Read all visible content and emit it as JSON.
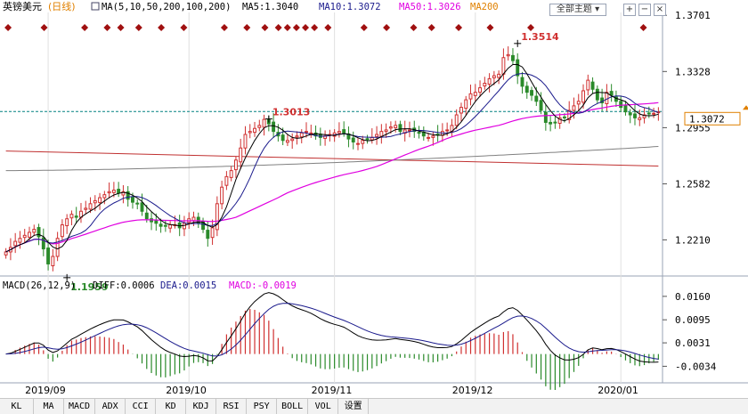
{
  "header": {
    "title": "英镑美元",
    "period": "(日线)",
    "ma_params": "MA(5,10,50,200,100,200)",
    "ma5": "MA5:1.3040",
    "ma10": "MA10:1.3072",
    "ma50": "MA50:1.3026",
    "ma200": "MA200",
    "dropdown_label": "全部主题",
    "buttons": [
      "+",
      "−",
      "×"
    ]
  },
  "macd_header": {
    "params": "MACD(26,12,9)",
    "diff": "DIFF:0.0006",
    "dea": "DEA:0.0015",
    "macd": "MACD:-0.0019"
  },
  "toolbar": [
    "KL",
    "MA",
    "MACD",
    "ADX",
    "CCI",
    "KD",
    "KDJ",
    "RSI",
    "PSY",
    "BOLL",
    "VOL",
    "设置"
  ],
  "chart_data": {
    "type": "candlestick",
    "price_axis_ticks": [
      "1.3701",
      "1.3328",
      "1.2955",
      "1.2582",
      "1.2210"
    ],
    "price_ylim": [
      1.197,
      1.372
    ],
    "current_price_label": "1.3072",
    "current_price": 1.3062,
    "annotations": [
      {
        "label": "1.3514",
        "value": 1.3514,
        "kind": "high"
      },
      {
        "label": "1.3013",
        "value": 1.3013,
        "kind": "swing-high"
      },
      {
        "label": "1.1959",
        "value": 1.1959,
        "kind": "low"
      }
    ],
    "x_date_labels": [
      {
        "label": "2019/09",
        "index": 9
      },
      {
        "label": "2019/10",
        "index": 39
      },
      {
        "label": "2019/11",
        "index": 70
      },
      {
        "label": "2019/12",
        "index": 100
      },
      {
        "label": "2020/01",
        "index": 131
      }
    ],
    "closes": [
      1.213,
      1.216,
      1.22,
      1.222,
      1.224,
      1.226,
      1.228,
      1.223,
      1.215,
      1.205,
      1.21,
      1.222,
      1.231,
      1.235,
      1.238,
      1.236,
      1.24,
      1.242,
      1.245,
      1.247,
      1.249,
      1.251,
      1.253,
      1.254,
      1.252,
      1.253,
      1.248,
      1.246,
      1.245,
      1.24,
      1.235,
      1.233,
      1.232,
      1.23,
      1.23,
      1.231,
      1.231,
      1.229,
      1.232,
      1.235,
      1.236,
      1.232,
      1.228,
      1.222,
      1.229,
      1.245,
      1.256,
      1.263,
      1.267,
      1.274,
      1.282,
      1.291,
      1.293,
      1.295,
      1.297,
      1.301,
      1.298,
      1.293,
      1.29,
      1.287,
      1.287,
      1.288,
      1.29,
      1.292,
      1.293,
      1.292,
      1.29,
      1.289,
      1.29,
      1.291,
      1.292,
      1.293,
      1.292,
      1.288,
      1.286,
      1.285,
      1.287,
      1.288,
      1.289,
      1.291,
      1.293,
      1.294,
      1.296,
      1.297,
      1.293,
      1.294,
      1.294,
      1.293,
      1.292,
      1.29,
      1.289,
      1.29,
      1.291,
      1.293,
      1.294,
      1.297,
      1.304,
      1.309,
      1.314,
      1.318,
      1.319,
      1.322,
      1.325,
      1.328,
      1.33,
      1.331,
      1.342,
      1.344,
      1.34,
      1.33,
      1.323,
      1.319,
      1.317,
      1.313,
      1.307,
      1.299,
      1.298,
      1.299,
      1.302,
      1.302,
      1.307,
      1.31,
      1.313,
      1.32,
      1.327,
      1.321,
      1.314,
      1.312,
      1.319,
      1.317,
      1.313,
      1.309,
      1.306,
      1.304,
      1.302,
      1.302,
      1.304,
      1.305,
      1.305,
      1.306
    ],
    "ma_lines": [
      {
        "name": "MA5",
        "color": "#000000",
        "values": "computed from closes, 5-period"
      },
      {
        "name": "MA10",
        "color": "#1a1a8c",
        "values": "computed from closes, 10-period"
      },
      {
        "name": "MA50",
        "color": "#e000e0",
        "values": "computed from closes, 50-period"
      },
      {
        "name": "MA200",
        "color": "#c03030",
        "start": 1.28,
        "end": 1.27
      },
      {
        "name": "MA100",
        "color": "#808080",
        "start": 1.267,
        "end": 1.283
      }
    ],
    "macd_axis_ticks": [
      "0.0160",
      "0.0095",
      "0.0031",
      "-0.0034"
    ],
    "macd_ylim": [
      -0.0075,
      0.0172
    ],
    "colors": {
      "up": "#d03030",
      "down": "#2a8a2a",
      "macd_pos": "#d03030",
      "macd_neg": "#2a8a2a",
      "diff": "#000000",
      "dea": "#1a1a8c",
      "cur_price_line": "#008080",
      "signal_marker": "#a01010"
    }
  }
}
